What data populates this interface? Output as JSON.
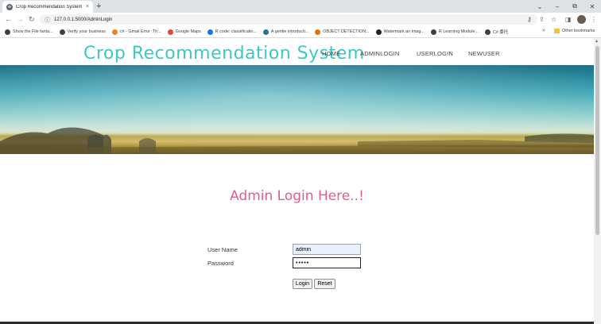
{
  "browser": {
    "tab_title": "Crop Recommendation System",
    "tab_close": "×",
    "new_tab": "+",
    "url": "127.0.0.1:5000/AdminLogin",
    "window_controls": {
      "dropdown": "⌄",
      "minimize": "–",
      "restore": "⧉",
      "close": "✕"
    },
    "nav": {
      "back": "←",
      "forward": "→",
      "reload": "↻"
    },
    "bookmarks": [
      {
        "label": "Show the File fanta...",
        "color": "#3c4043"
      },
      {
        "label": "Verify your business",
        "color": "#3c4043"
      },
      {
        "label": "c# - Gmail Error :Th...",
        "color": "#f48024"
      },
      {
        "label": "Google Maps",
        "color": "#ea4335"
      },
      {
        "label": "R code: classificatio...",
        "color": "#1a73e8"
      },
      {
        "label": "A gentle introducti...",
        "color": "#21759b"
      },
      {
        "label": "OBJECT DETECTION...",
        "color": "#e37400"
      },
      {
        "label": "Watermark an imag...",
        "color": "#202124"
      },
      {
        "label": "R Learning Module...",
        "color": "#3c4043"
      },
      {
        "label": "C# 委托",
        "color": "#3c4043"
      }
    ],
    "bookmarks_overflow": "»",
    "other_bookmarks": "Other bookmarks"
  },
  "site": {
    "logo": "Crop Recommendation System",
    "nav": [
      "HOME",
      "ADMINLOGIN",
      "USERLOGIN",
      "NEWUSER"
    ]
  },
  "login": {
    "heading": "Admin Login Here..!",
    "username_label": "User Name",
    "password_label": "Password",
    "username_value": "admin",
    "password_value": "•••••",
    "login_button": "Login",
    "reset_button": "Reset"
  },
  "colors": {
    "logo": "#3ec7c4",
    "heading": "#e05c8a"
  }
}
